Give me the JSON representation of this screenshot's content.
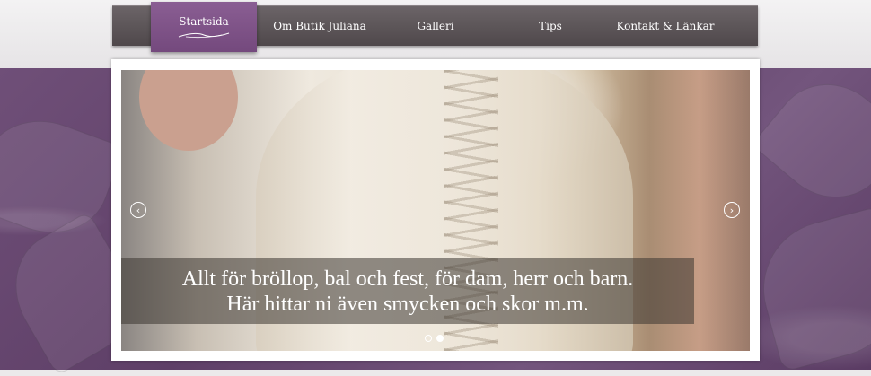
{
  "nav": {
    "items": [
      {
        "label": "Startsida",
        "active": true
      },
      {
        "label": "Om Butik Juliana",
        "active": false
      },
      {
        "label": "Galleri",
        "active": false
      },
      {
        "label": "Tips",
        "active": false
      },
      {
        "label": "Kontakt & Länkar",
        "active": false
      }
    ]
  },
  "slider": {
    "caption_line1": "Allt för bröllop, bal och fest, för dam, herr och barn.",
    "caption_line2": "Här hittar ni även smycken och skor m.m.",
    "prev_icon": "chevron-left-icon",
    "next_icon": "chevron-right-icon",
    "slide_count": 2,
    "current_slide": 2
  },
  "colors": {
    "nav_bg": "#4f484b",
    "nav_active": "#7e5387",
    "background_purple": "#6a4b73"
  }
}
